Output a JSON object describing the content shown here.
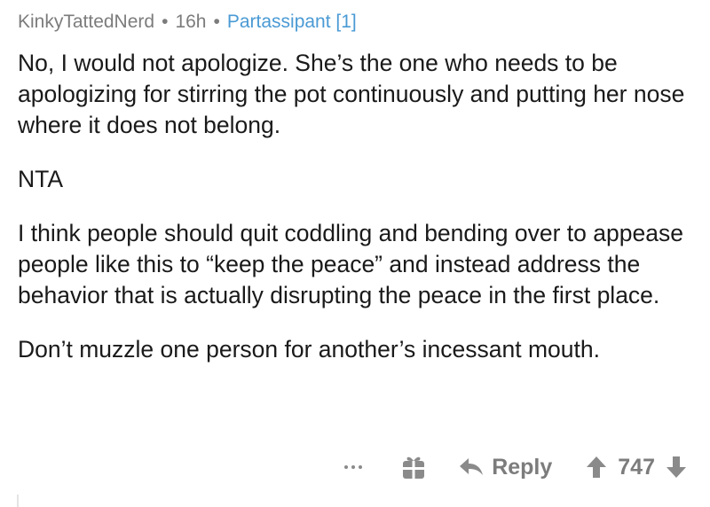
{
  "comment": {
    "author": "KinkyTattedNerd",
    "separator": "•",
    "age": "16h",
    "flair": "Partassipant [1]",
    "paragraphs": [
      "No, I would not apologize. She’s the one who needs to be apologizing for stirring the pot continuously and putting her nose where it does not belong.",
      "NTA",
      "I think people should quit coddling and bending over to appease people like this to “keep the peace” and instead address the behavior that is actually disrupting the peace in the first place.",
      "Don’t muzzle one person for another’s incessant mouth."
    ],
    "actions": {
      "more_icon": "ellipsis-icon",
      "award_icon": "gift-icon",
      "reply_icon": "reply-arrow-icon",
      "reply_label": "Reply",
      "upvote_icon": "upvote-arrow-icon",
      "score": "747",
      "downvote_icon": "downvote-arrow-icon"
    }
  },
  "colors": {
    "meta_text": "#7c7c7c",
    "flair_text": "#4a9ad4",
    "body_text": "#1a1a1a",
    "action_gray": "#7c7c7c"
  }
}
